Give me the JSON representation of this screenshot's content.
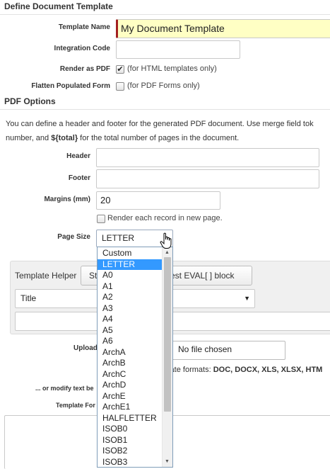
{
  "section_define": "Define Document Template",
  "template_name": {
    "label": "Template Name",
    "value": "My Document Template"
  },
  "integration_code": {
    "label": "Integration Code",
    "value": ""
  },
  "render_pdf": {
    "label": "Render as PDF",
    "checked": true,
    "note": "(for HTML templates only)"
  },
  "flatten": {
    "label": "Flatten Populated Form",
    "checked": false,
    "note": "(for PDF Forms only)"
  },
  "section_pdf": "PDF Options",
  "pdf_desc": {
    "line1": "You can define a header and footer for the generated PDF document. Use merge field tok",
    "line2_prefix": "number, and ",
    "line2_token": "${total}",
    "line2_suffix": " for the total number of pages in the document."
  },
  "header": {
    "label": "Header",
    "value": ""
  },
  "footer": {
    "label": "Footer",
    "value": ""
  },
  "margins": {
    "label": "Margins (mm)",
    "value": "20"
  },
  "render_each": {
    "label": "Render each record in new page.",
    "checked": false
  },
  "page_size": {
    "label": "Page Size",
    "value": "LETTER",
    "options": [
      "Custom",
      "LETTER",
      "A0",
      "A1",
      "A2",
      "A3",
      "A4",
      "A5",
      "A6",
      "ArchA",
      "ArchB",
      "ArchC",
      "ArchD",
      "ArchE",
      "ArchE1",
      "HALFLETTER",
      "ISOB0",
      "ISOB1",
      "ISOB2",
      "ISOB3"
    ],
    "selected_option": "LETTER"
  },
  "template_helper": {
    "label": "Template Helper",
    "button1": "St",
    "button2": "est EVAL[ ] block",
    "select_value": "Title"
  },
  "upload": {
    "label": "Upload",
    "file_status": "No file chosen"
  },
  "formats": {
    "prefix": "plate formats: ",
    "list": "DOC, DOCX, XLS, XLSX, HTM"
  },
  "modify_label": "... or modify text be",
  "template_for_label": "Template For"
}
